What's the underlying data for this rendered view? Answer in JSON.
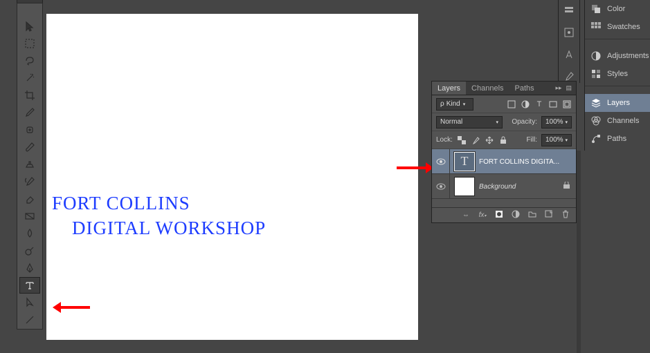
{
  "canvas": {
    "line1": "FORT COLLINS",
    "line2": "DIGITAL WORKSHOP"
  },
  "toolbar": {
    "tools": [
      "move",
      "marquee",
      "lasso",
      "magic-wand",
      "crop",
      "eyedropper",
      "healing",
      "brush",
      "stamp",
      "history-brush",
      "eraser",
      "gradient",
      "blur",
      "dodge",
      "pen",
      "type",
      "path-select",
      "line"
    ]
  },
  "layers_panel": {
    "tabs": {
      "active": "Layers",
      "others": [
        "Channels",
        "Paths"
      ]
    },
    "kind_label": "Kind",
    "blend_mode": "Normal",
    "opacity_label": "Opacity:",
    "opacity_value": "100%",
    "lock_label": "Lock:",
    "fill_label": "Fill:",
    "fill_value": "100%",
    "layers": [
      {
        "name": "FORT COLLINS   DIGITA...",
        "type": "text",
        "selected": true
      },
      {
        "name": "Background",
        "type": "raster",
        "locked": true
      }
    ]
  },
  "right_dock": {
    "items": [
      {
        "label": "Color",
        "icon": "color"
      },
      {
        "label": "Swatches",
        "icon": "swatches"
      },
      {
        "label": "Adjustments",
        "icon": "adjustments"
      },
      {
        "label": "Styles",
        "icon": "styles"
      },
      {
        "label": "Layers",
        "icon": "layers",
        "selected": true
      },
      {
        "label": "Channels",
        "icon": "channels"
      },
      {
        "label": "Paths",
        "icon": "paths"
      }
    ]
  }
}
